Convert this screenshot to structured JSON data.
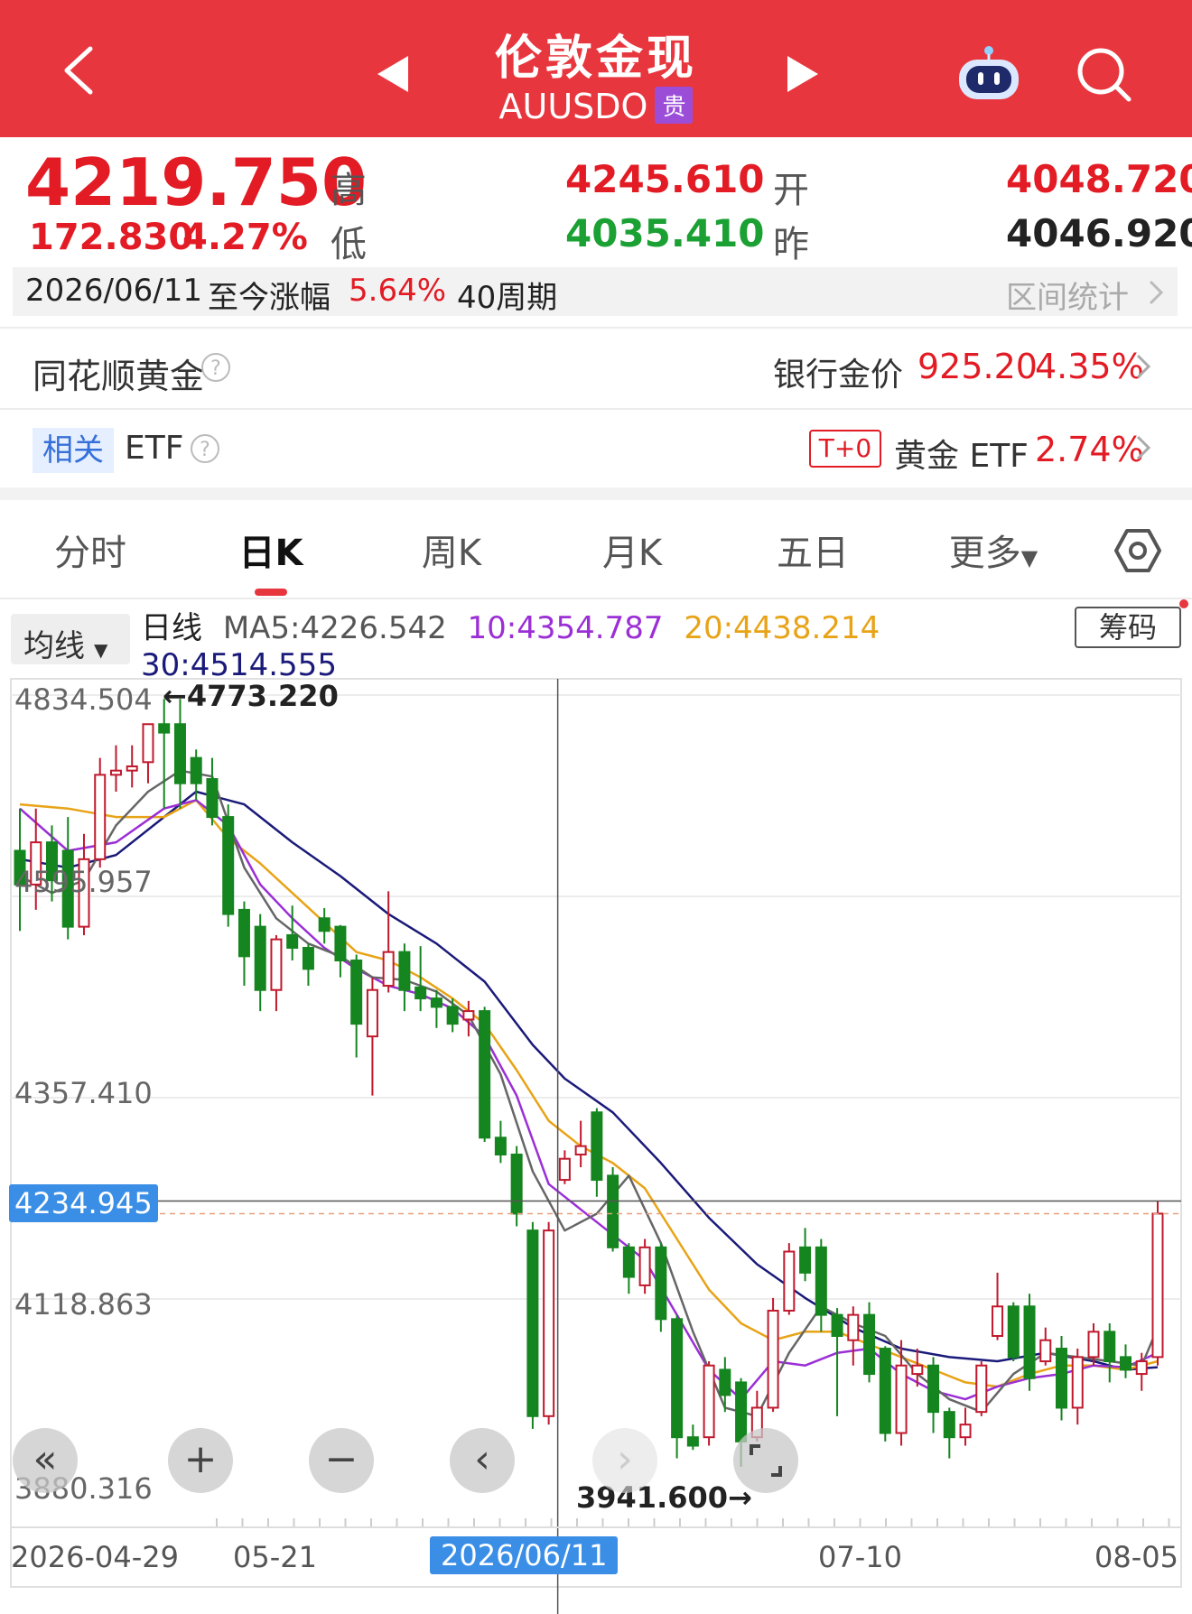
{
  "header": {
    "title": "伦敦金现",
    "code": "AUUSDO",
    "badge": "贵"
  },
  "quote": {
    "price": "4219.750",
    "change": "172.830",
    "change_pct": "4.27%",
    "high_label": "高",
    "high": "4245.610",
    "low_label": "低",
    "low": "4035.410",
    "open_label": "开",
    "open": "4048.720",
    "prev_label": "昨",
    "prev": "4046.920"
  },
  "range": {
    "date": "2026/06/11",
    "text1": "至今涨幅",
    "pct": "5.64%",
    "period": "40周期",
    "stats": "区间统计"
  },
  "gold": {
    "label": "同花顺黄金",
    "bank_label": "银行金价",
    "bank_price": "925.20",
    "bank_pct": "4.35%"
  },
  "etf": {
    "tag": "相关",
    "label": "ETF",
    "t0": "T+0",
    "name": "黄金 ETF",
    "pct": "2.74%"
  },
  "tabs": [
    "分时",
    "日K",
    "周K",
    "月K",
    "五日",
    "更多"
  ],
  "chart_header": {
    "ma_button": "均线",
    "line_type": "日线",
    "ma5": "MA5:4226.542",
    "ma10": "10:4354.787",
    "ma20": "20:4438.214",
    "ma30": "30:4514.555",
    "chip_button": "筹码",
    "colors": {
      "ma5": "#666666",
      "ma10": "#9b2fd6",
      "ma20": "#e8a317",
      "ma30": "#1a1a7a",
      "up": "#c0192d",
      "down": "#15851f"
    }
  },
  "chart_data": {
    "type": "candlestick",
    "y_ticks": [
      "4834.504",
      "4595.957",
      "4357.410",
      "4118.863",
      "3880.316"
    ],
    "ylim": [
      3880.316,
      4834.504
    ],
    "x_ticks": [
      "2026-04-29",
      "05-21",
      "2026/06/11",
      "07-10",
      "08-05"
    ],
    "max_label": "←4773.220",
    "min_label": "3941.600→",
    "crosshair_price": "4234.945",
    "crosshair_date": "2026/06/11",
    "candles": [
      {
        "o": 4650,
        "c": 4610,
        "h": 4700,
        "l": 4555
      },
      {
        "o": 4610,
        "c": 4660,
        "h": 4700,
        "l": 4580
      },
      {
        "o": 4660,
        "c": 4615,
        "h": 4680,
        "l": 4590
      },
      {
        "o": 4650,
        "c": 4560,
        "h": 4690,
        "l": 4545
      },
      {
        "o": 4560,
        "c": 4640,
        "h": 4670,
        "l": 4550
      },
      {
        "o": 4640,
        "c": 4740,
        "h": 4760,
        "l": 4630
      },
      {
        "o": 4740,
        "c": 4745,
        "h": 4775,
        "l": 4720
      },
      {
        "o": 4745,
        "c": 4750,
        "h": 4775,
        "l": 4725
      },
      {
        "o": 4755,
        "c": 4800,
        "h": 4800,
        "l": 4730
      },
      {
        "o": 4800,
        "c": 4790,
        "h": 4830,
        "l": 4700
      },
      {
        "o": 4800,
        "c": 4730,
        "h": 4830,
        "l": 4700
      },
      {
        "o": 4760,
        "c": 4730,
        "h": 4770,
        "l": 4710
      },
      {
        "o": 4735,
        "c": 4690,
        "h": 4760,
        "l": 4680
      },
      {
        "o": 4690,
        "c": 4575,
        "h": 4705,
        "l": 4560
      },
      {
        "o": 4580,
        "c": 4525,
        "h": 4590,
        "l": 4490
      },
      {
        "o": 4560,
        "c": 4485,
        "h": 4575,
        "l": 4460
      },
      {
        "o": 4485,
        "c": 4545,
        "h": 4550,
        "l": 4460
      },
      {
        "o": 4550,
        "c": 4535,
        "h": 4585,
        "l": 4520
      },
      {
        "o": 4535,
        "c": 4510,
        "h": 4540,
        "l": 4490
      },
      {
        "o": 4570,
        "c": 4555,
        "h": 4582,
        "l": 4540
      },
      {
        "o": 4560,
        "c": 4520,
        "h": 4562,
        "l": 4500
      },
      {
        "o": 4520,
        "c": 4445,
        "h": 4527,
        "l": 4405
      },
      {
        "o": 4430,
        "c": 4485,
        "h": 4500,
        "l": 4360
      },
      {
        "o": 4490,
        "c": 4530,
        "h": 4602,
        "l": 4482
      },
      {
        "o": 4530,
        "c": 4485,
        "h": 4540,
        "l": 4460
      },
      {
        "o": 4488,
        "c": 4475,
        "h": 4537,
        "l": 4460
      },
      {
        "o": 4475,
        "c": 4465,
        "h": 4485,
        "l": 4440
      },
      {
        "o": 4465,
        "c": 4445,
        "h": 4475,
        "l": 4435
      },
      {
        "o": 4450,
        "c": 4460,
        "h": 4472,
        "l": 4430
      },
      {
        "o": 4460,
        "c": 4310,
        "h": 4465,
        "l": 4305
      },
      {
        "o": 4310,
        "c": 4290,
        "h": 4330,
        "l": 4280
      },
      {
        "o": 4290,
        "c": 4220,
        "h": 4300,
        "l": 4205
      },
      {
        "o": 4200,
        "c": 3980,
        "h": 4210,
        "l": 3965
      },
      {
        "o": 3980,
        "c": 4200,
        "h": 4210,
        "l": 3970
      },
      {
        "o": 4260,
        "c": 4285,
        "h": 4295,
        "l": 4255
      },
      {
        "o": 4290,
        "c": 4300,
        "h": 4330,
        "l": 4275
      },
      {
        "o": 4340,
        "c": 4260,
        "h": 4345,
        "l": 4240
      },
      {
        "o": 4265,
        "c": 4180,
        "h": 4275,
        "l": 4175
      },
      {
        "o": 4180,
        "c": 4145,
        "h": 4185,
        "l": 4125
      },
      {
        "o": 4135,
        "c": 4180,
        "h": 4190,
        "l": 4125
      },
      {
        "o": 4180,
        "c": 4095,
        "h": 4185,
        "l": 4080
      },
      {
        "o": 4095,
        "c": 3955,
        "h": 4100,
        "l": 3930
      },
      {
        "o": 3955,
        "c": 3945,
        "h": 3970,
        "l": 3940
      },
      {
        "o": 3955,
        "c": 4040,
        "h": 4045,
        "l": 3945
      },
      {
        "o": 4035,
        "c": 4005,
        "h": 4050,
        "l": 3985
      },
      {
        "o": 4020,
        "c": 3950,
        "h": 4025,
        "l": 3920
      },
      {
        "o": 3955,
        "c": 3990,
        "h": 4010,
        "l": 3950
      },
      {
        "o": 3990,
        "c": 4105,
        "h": 4120,
        "l": 3985
      },
      {
        "o": 4105,
        "c": 4175,
        "h": 4185,
        "l": 4100
      },
      {
        "o": 4180,
        "c": 4150,
        "h": 4203,
        "l": 4140
      },
      {
        "o": 4180,
        "c": 4100,
        "h": 4190,
        "l": 4080
      },
      {
        "o": 4100,
        "c": 4075,
        "h": 4108,
        "l": 3980
      },
      {
        "o": 4070,
        "c": 4100,
        "h": 4110,
        "l": 4040
      },
      {
        "o": 4100,
        "c": 4030,
        "h": 4115,
        "l": 4020
      },
      {
        "o": 4060,
        "c": 3960,
        "h": 4063,
        "l": 3950
      },
      {
        "o": 3960,
        "c": 4040,
        "h": 4070,
        "l": 3945
      },
      {
        "o": 4030,
        "c": 4040,
        "h": 4060,
        "l": 4015
      },
      {
        "o": 4040,
        "c": 3985,
        "h": 4050,
        "l": 3960
      },
      {
        "o": 3985,
        "c": 3955,
        "h": 3990,
        "l": 3930
      },
      {
        "o": 3955,
        "c": 3970,
        "h": 3990,
        "l": 3945
      },
      {
        "o": 3985,
        "c": 4040,
        "h": 4045,
        "l": 3980
      },
      {
        "o": 4075,
        "c": 4110,
        "h": 4150,
        "l": 4070
      },
      {
        "o": 4110,
        "c": 4050,
        "h": 4115,
        "l": 4045
      },
      {
        "o": 4110,
        "c": 4025,
        "h": 4125,
        "l": 4010
      },
      {
        "o": 4045,
        "c": 4070,
        "h": 4085,
        "l": 4040
      },
      {
        "o": 4060,
        "c": 3990,
        "h": 4075,
        "l": 3975
      },
      {
        "o": 3990,
        "c": 4050,
        "h": 4060,
        "l": 3970
      },
      {
        "o": 4050,
        "c": 4080,
        "h": 4090,
        "l": 4040
      },
      {
        "o": 4080,
        "c": 4045,
        "h": 4090,
        "l": 4020
      },
      {
        "o": 4050,
        "c": 4035,
        "h": 4065,
        "l": 4025
      },
      {
        "o": 4030,
        "c": 4045,
        "h": 4055,
        "l": 4010
      },
      {
        "o": 4050,
        "c": 4220,
        "h": 4235,
        "l": 4040
      }
    ],
    "ma5": [
      [
        0,
        4620
      ],
      [
        2,
        4600
      ],
      [
        4,
        4615
      ],
      [
        6,
        4680
      ],
      [
        8,
        4720
      ],
      [
        10,
        4745
      ],
      [
        12,
        4738
      ],
      [
        14,
        4630
      ],
      [
        16,
        4570
      ],
      [
        18,
        4540
      ],
      [
        20,
        4525
      ],
      [
        22,
        4500
      ],
      [
        24,
        4497
      ],
      [
        26,
        4483
      ],
      [
        28,
        4455
      ],
      [
        30,
        4385
      ],
      [
        32,
        4270
      ],
      [
        34,
        4200
      ],
      [
        36,
        4220
      ],
      [
        38,
        4265
      ],
      [
        40,
        4185
      ],
      [
        42,
        4080
      ],
      [
        44,
        3990
      ],
      [
        46,
        3980
      ],
      [
        48,
        4055
      ],
      [
        50,
        4110
      ],
      [
        52,
        4090
      ],
      [
        54,
        4075
      ],
      [
        56,
        4030
      ],
      [
        58,
        4000
      ],
      [
        60,
        3985
      ],
      [
        62,
        4030
      ],
      [
        64,
        4055
      ],
      [
        66,
        4050
      ],
      [
        68,
        4045
      ],
      [
        70,
        4040
      ],
      [
        71,
        4085
      ]
    ],
    "ma10": [
      [
        0,
        4700
      ],
      [
        3,
        4650
      ],
      [
        6,
        4660
      ],
      [
        9,
        4700
      ],
      [
        11,
        4710
      ],
      [
        13,
        4680
      ],
      [
        15,
        4610
      ],
      [
        17,
        4570
      ],
      [
        19,
        4535
      ],
      [
        21,
        4510
      ],
      [
        23,
        4490
      ],
      [
        25,
        4480
      ],
      [
        27,
        4463
      ],
      [
        29,
        4430
      ],
      [
        31,
        4360
      ],
      [
        33,
        4255
      ],
      [
        35,
        4225
      ],
      [
        37,
        4195
      ],
      [
        39,
        4165
      ],
      [
        41,
        4100
      ],
      [
        43,
        4035
      ],
      [
        45,
        4000
      ],
      [
        47,
        4045
      ],
      [
        49,
        4040
      ],
      [
        51,
        4055
      ],
      [
        53,
        4060
      ],
      [
        55,
        4030
      ],
      [
        57,
        4010
      ],
      [
        59,
        4000
      ],
      [
        61,
        4015
      ],
      [
        63,
        4025
      ],
      [
        65,
        4030
      ],
      [
        67,
        4040
      ],
      [
        69,
        4038
      ],
      [
        71,
        4055
      ]
    ],
    "ma20": [
      [
        0,
        4705
      ],
      [
        3,
        4700
      ],
      [
        6,
        4690
      ],
      [
        9,
        4690
      ],
      [
        11,
        4710
      ],
      [
        13,
        4665
      ],
      [
        15,
        4635
      ],
      [
        17,
        4600
      ],
      [
        19,
        4565
      ],
      [
        21,
        4530
      ],
      [
        23,
        4520
      ],
      [
        25,
        4500
      ],
      [
        27,
        4475
      ],
      [
        29,
        4445
      ],
      [
        31,
        4390
      ],
      [
        33,
        4330
      ],
      [
        35,
        4300
      ],
      [
        37,
        4280
      ],
      [
        39,
        4250
      ],
      [
        41,
        4190
      ],
      [
        43,
        4130
      ],
      [
        45,
        4090
      ],
      [
        47,
        4070
      ],
      [
        49,
        4080
      ],
      [
        51,
        4080
      ],
      [
        53,
        4065
      ],
      [
        55,
        4050
      ],
      [
        57,
        4035
      ],
      [
        59,
        4020
      ],
      [
        61,
        4015
      ],
      [
        63,
        4030
      ],
      [
        65,
        4040
      ],
      [
        67,
        4040
      ],
      [
        69,
        4035
      ],
      [
        71,
        4045
      ]
    ],
    "ma30": [
      [
        0,
        4640
      ],
      [
        3,
        4630
      ],
      [
        6,
        4645
      ],
      [
        9,
        4690
      ],
      [
        11,
        4720
      ],
      [
        14,
        4705
      ],
      [
        17,
        4660
      ],
      [
        20,
        4620
      ],
      [
        23,
        4575
      ],
      [
        26,
        4540
      ],
      [
        29,
        4495
      ],
      [
        32,
        4420
      ],
      [
        34,
        4380
      ],
      [
        37,
        4340
      ],
      [
        40,
        4280
      ],
      [
        43,
        4215
      ],
      [
        46,
        4160
      ],
      [
        49,
        4120
      ],
      [
        52,
        4085
      ],
      [
        55,
        4060
      ],
      [
        58,
        4050
      ],
      [
        61,
        4045
      ],
      [
        64,
        4055
      ],
      [
        67,
        4045
      ],
      [
        69,
        4035
      ],
      [
        71,
        4038
      ]
    ]
  },
  "controls": {
    "zoom_in": "+",
    "zoom_out": "−",
    "rewind": "«",
    "prev": "‹",
    "next": "›"
  }
}
